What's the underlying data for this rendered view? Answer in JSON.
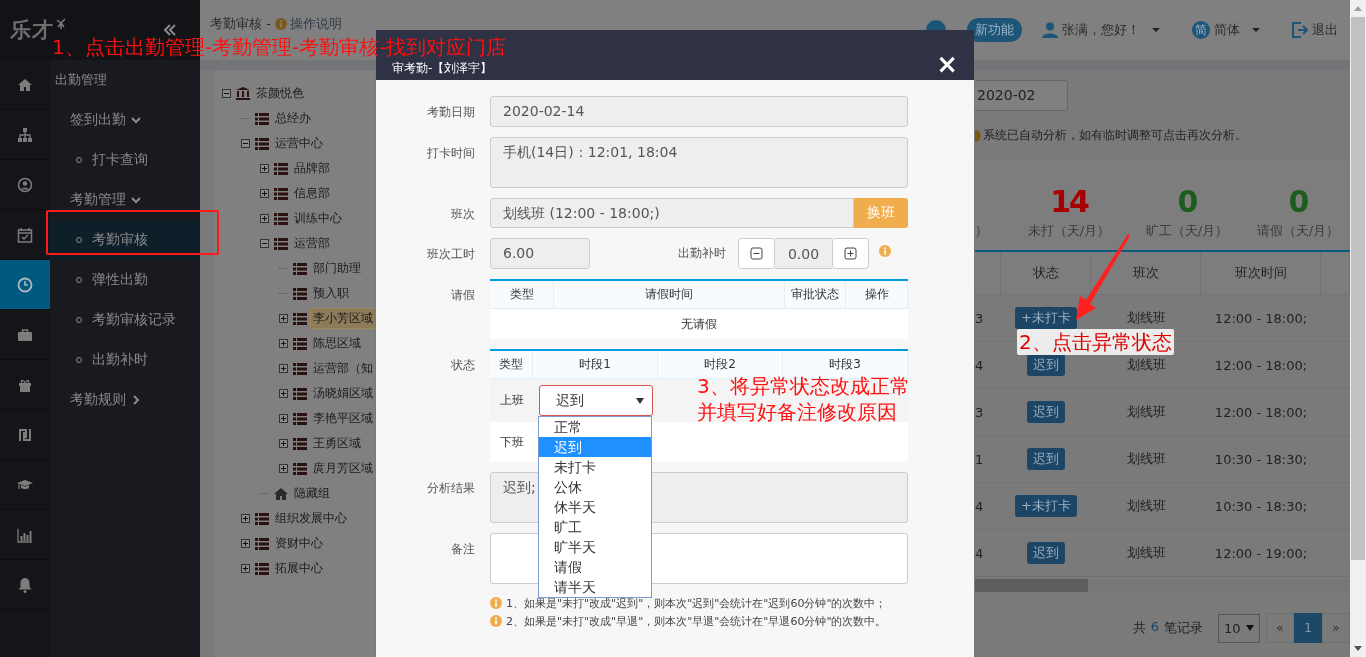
{
  "brand": {
    "logo": "乐才"
  },
  "rail": [
    {
      "kind": "home",
      "selected": false
    },
    {
      "kind": "sitemap",
      "selected": false
    },
    {
      "kind": "user",
      "selected": false
    },
    {
      "kind": "calendar",
      "selected": false
    },
    {
      "kind": "clock",
      "selected": true
    },
    {
      "kind": "briefcase",
      "selected": false
    },
    {
      "kind": "gift",
      "selected": false
    },
    {
      "kind": "shekel",
      "selected": false
    },
    {
      "kind": "cap",
      "selected": false
    },
    {
      "kind": "chart",
      "selected": false
    },
    {
      "kind": "bell",
      "selected": false
    }
  ],
  "nav": {
    "title": "出勤管理",
    "groups": [
      {
        "label": "签到出勤",
        "expanded": true,
        "items": [
          {
            "label": "打卡查询",
            "selected": false
          }
        ]
      },
      {
        "label": "考勤管理",
        "expanded": true,
        "items": [
          {
            "label": "考勤审核",
            "selected": true
          },
          {
            "label": "弹性出勤",
            "selected": false
          },
          {
            "label": "考勤审核记录",
            "selected": false
          },
          {
            "label": "出勤补时",
            "selected": false
          }
        ]
      },
      {
        "label": "考勤规则",
        "expanded": false
      }
    ]
  },
  "header": {
    "page_title": "考勤审核 -",
    "help_link": "操作说明",
    "new_feature": "新功能",
    "greeting": "张满，您好！",
    "language_badge": "简",
    "language": "简体",
    "logout": "退出"
  },
  "tree": [
    {
      "label": "茶颜悦色",
      "kind": "org",
      "expanded": true,
      "selected": false,
      "children": [
        {
          "label": "总经办",
          "kind": "dept",
          "selected": false
        },
        {
          "label": "运营中心",
          "kind": "dept",
          "expanded": true,
          "selected": false,
          "children": [
            {
              "label": "品牌部",
              "kind": "dept",
              "expanded": false,
              "selected": false
            },
            {
              "label": "信息部",
              "kind": "dept",
              "expanded": false,
              "selected": false
            },
            {
              "label": "训练中心",
              "kind": "dept",
              "expanded": false,
              "selected": false
            },
            {
              "label": "运营部",
              "kind": "dept",
              "expanded": true,
              "selected": false,
              "children": [
                {
                  "label": "部门助理",
                  "kind": "dept",
                  "selected": false
                },
                {
                  "label": "预入职",
                  "kind": "dept",
                  "selected": false
                },
                {
                  "label": "李小芳区域",
                  "kind": "dept",
                  "expanded": false,
                  "selected": true
                },
                {
                  "label": "陈思区域",
                  "kind": "dept",
                  "expanded": false,
                  "selected": false
                },
                {
                  "label": "运营部（知",
                  "kind": "dept",
                  "expanded": false,
                  "selected": false
                },
                {
                  "label": "汤晓娟区域",
                  "kind": "dept",
                  "expanded": false,
                  "selected": false
                },
                {
                  "label": "李艳平区域",
                  "kind": "dept",
                  "expanded": false,
                  "selected": false
                },
                {
                  "label": "王勇区域",
                  "kind": "dept",
                  "expanded": false,
                  "selected": false
                },
                {
                  "label": "庹月芳区域",
                  "kind": "dept",
                  "expanded": false,
                  "selected": false
                }
              ]
            },
            {
              "label": "隐藏组",
              "kind": "group",
              "selected": false
            }
          ]
        },
        {
          "label": "组织发展中心",
          "kind": "dept",
          "expanded": false,
          "selected": false
        },
        {
          "label": "资财中心",
          "kind": "dept",
          "expanded": false,
          "selected": false
        },
        {
          "label": "拓展中心",
          "kind": "dept",
          "expanded": false,
          "selected": false
        }
      ]
    }
  ],
  "month": "2020-02",
  "hint": "系统已自动分析，如有临时调整可点击再次分析。",
  "stats": [
    {
      "label": "）"
    },
    {
      "value": "14",
      "label": "未打（天/月）",
      "color": "#a80000"
    },
    {
      "value": "0",
      "label": "旷工（天/月）",
      "color": "#1c5c1c"
    },
    {
      "value": "0",
      "label": "请假（天/月）",
      "color": "#1c5c1c"
    }
  ],
  "records": {
    "columns": [
      "状态",
      "班次",
      "班次时间"
    ],
    "rows": [
      {
        "column_1": "3",
        "status": "+未打卡",
        "shift": "划线班",
        "time": "12:00 - 18:00;"
      },
      {
        "column_1": "4",
        "status": "迟到",
        "shift": "划线班",
        "time": "12:00 - 18:00;"
      },
      {
        "column_1": "3",
        "status": "迟到",
        "shift": "划线班",
        "time": "12:00 - 18:00;"
      },
      {
        "column_1": "1",
        "status": "迟到",
        "shift": "划线班",
        "time": "10:30 - 18:30;"
      },
      {
        "column_1": "4",
        "status": "+未打卡",
        "shift": "划线班",
        "time": "10:30 - 18:30;"
      },
      {
        "column_1": "4",
        "status": "迟到",
        "shift": "划线班",
        "time": "12:00 - 19:00;"
      }
    ]
  },
  "pagination": {
    "total_prefix": "共",
    "total_count": "6",
    "total_suffix": "笔记录",
    "page_size": "10",
    "pages": [
      {
        "label": "«",
        "selected": false
      },
      {
        "label": "1",
        "selected": true
      },
      {
        "label": "»",
        "selected": false
      }
    ]
  },
  "modal": {
    "title": "审考勤-【刘泽宇】",
    "close": "×",
    "date": {
      "label": "考勤日期",
      "value": "2020-02-14"
    },
    "punch": {
      "label": "打卡时间",
      "value": "手机(14日)：12:01, 18:04"
    },
    "shift": {
      "label": "班次",
      "value": "划线班 (12:00 - 18:00;)",
      "button": "换班"
    },
    "hours": {
      "label": "班次工时",
      "value": "6.00"
    },
    "extra_hours": {
      "label": "出勤补时",
      "value": "0.00"
    },
    "leave": {
      "label": "请假",
      "columns": [
        "类型",
        "请假时间",
        "审批状态",
        "操作"
      ],
      "empty": "无请假"
    },
    "status": {
      "label": "状态",
      "columns": [
        "类型",
        "时段1",
        "时段2",
        "时段3"
      ],
      "rows": [
        {
          "type": "上班",
          "slot_1": "迟到"
        },
        {
          "type": "下班"
        }
      ],
      "options": [
        {
          "label": "正常",
          "selected": false
        },
        {
          "label": "迟到",
          "selected": true
        },
        {
          "label": "未打卡",
          "selected": false
        },
        {
          "label": "公休",
          "selected": false
        },
        {
          "label": "休半天",
          "selected": false
        },
        {
          "label": "旷工",
          "selected": false
        },
        {
          "label": "旷半天",
          "selected": false
        },
        {
          "label": "请假",
          "selected": false
        },
        {
          "label": "请半天",
          "selected": false
        }
      ]
    },
    "analysis": {
      "label": "分析结果",
      "value": "迟到;"
    },
    "remark": {
      "label": "备注"
    },
    "notes": [
      "1、如果是\"未打\"改成\"迟到\"，则本次\"迟到\"会统计在\"迟到60分钟\"的次数中；",
      "2、如果是\"未打\"改成\"早退\"，则本次\"早退\"会统计在\"早退60分钟\"的次数中。"
    ]
  },
  "annotations": {
    "step_1": "1、点击出勤管理-考勤管理-考勤审核-找到对应门店",
    "step_2": "2、点击异常状态",
    "step_3": [
      "3、将异常状态改成正常",
      "并填写好备注修改原因"
    ]
  }
}
